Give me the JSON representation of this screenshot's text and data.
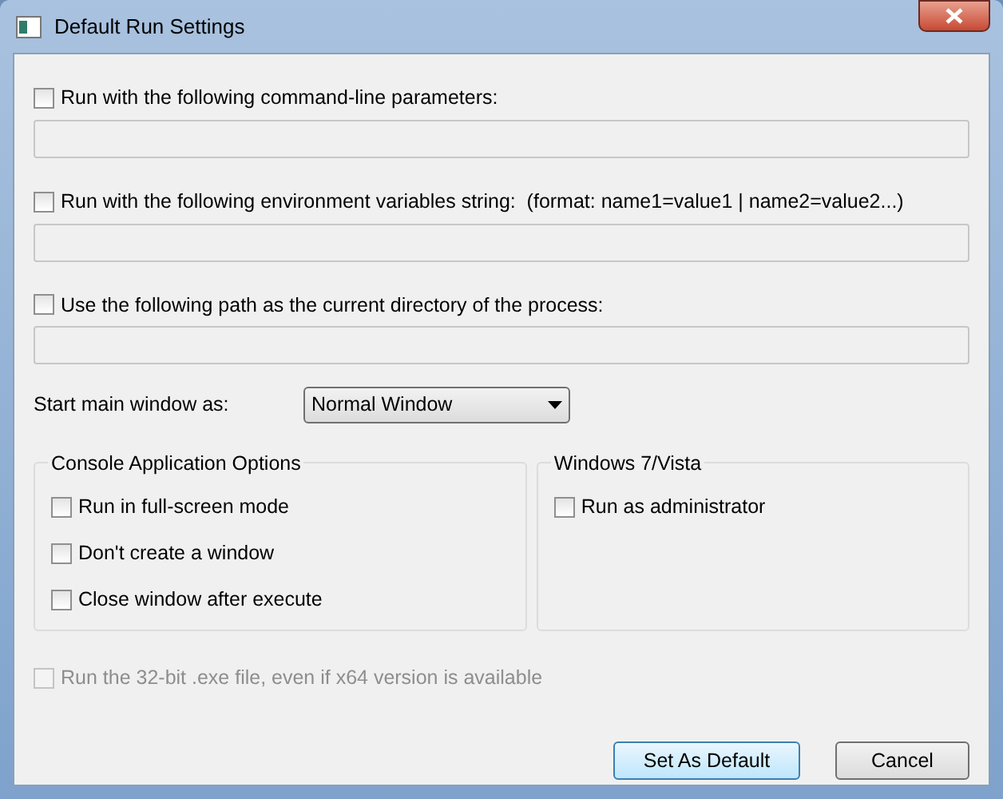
{
  "window": {
    "title": "Default Run Settings"
  },
  "options": [
    {
      "kind": "with-field",
      "label": "Run with the following command-line parameters:",
      "checked": false
    },
    {
      "kind": "with-field",
      "label": "Run with the following environment variables string:  (format: name1=value1 | name2=value2...)",
      "checked": false
    },
    {
      "kind": "with-field",
      "label": "Use the following path as the current directory of the process:",
      "checked": false
    }
  ],
  "start_window": {
    "label": "Start main window as:",
    "value": "Normal Window"
  },
  "groups": [
    {
      "title": "Console Application Options",
      "options": [
        {
          "label": "Run in full-screen mode",
          "checked": false
        },
        {
          "label": "Don't create a window",
          "checked": false
        },
        {
          "label": "Close window after execute",
          "checked": false
        }
      ]
    },
    {
      "title": "Windows 7/Vista",
      "options": [
        {
          "label": "Run as administrator",
          "checked": false
        }
      ]
    }
  ],
  "bit32_option": {
    "label": "Run the 32-bit .exe file, even if x64 version is available",
    "checked": false,
    "disabled": true
  },
  "buttons": [
    {
      "label": "Set As Default",
      "default": true
    },
    {
      "label": "Cancel",
      "default": false
    }
  ]
}
